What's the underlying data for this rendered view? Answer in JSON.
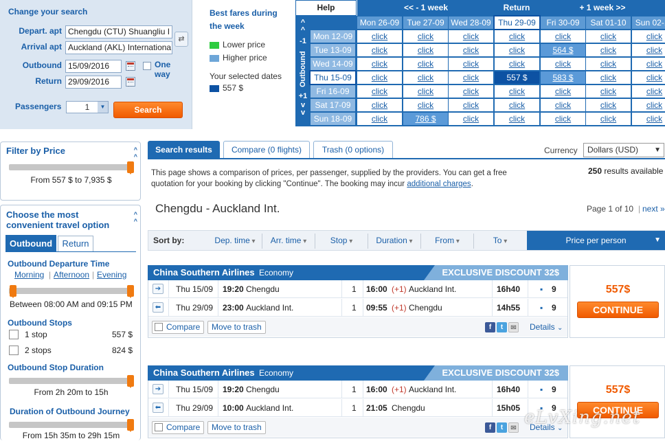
{
  "search": {
    "title": "Change your search",
    "depart_label": "Depart. apt",
    "depart_value": "Chengdu (CTU) Shuangliu I",
    "arrival_label": "Arrival apt",
    "arrival_value": "Auckland (AKL) Internationa",
    "outbound_label": "Outbound",
    "outbound_value": "15/09/2016",
    "return_label": "Return",
    "return_value": "29/09/2016",
    "oneway_label_1": "One",
    "oneway_label_2": "way",
    "passengers_label": "Passengers",
    "passengers_value": "1",
    "search_button": "Search"
  },
  "legend": {
    "title_1": "Best fares during",
    "title_2": "the week",
    "lower": "Lower price",
    "higher": "Higher price",
    "selected_title": "Your selected dates",
    "selected_price": "557 $",
    "colors": {
      "lower": "#2ecc40",
      "higher": "#6ea6d8",
      "selected": "#0d52a3"
    }
  },
  "calendar": {
    "help": "Help",
    "prev_week": "<< - 1 week",
    "return_label": "Return",
    "next_week": "+ 1 week >>",
    "outbound_side": "Outbound",
    "side_marks": [
      "^^",
      "-1",
      "+1",
      "vv"
    ],
    "columns": [
      "Mon 26-09",
      "Tue 27-09",
      "Wed 28-09",
      "Thu 29-09",
      "Fri 30-09",
      "Sat 01-10",
      "Sun 02-10"
    ],
    "rows": [
      {
        "label": "Mon 12-09",
        "cells": [
          "click",
          "click",
          "click",
          "click",
          "click",
          "click",
          "click"
        ]
      },
      {
        "label": "Tue 13-09",
        "cells": [
          "click",
          "click",
          "click",
          "click",
          "564 $",
          "click",
          "click"
        ]
      },
      {
        "label": "Wed 14-09",
        "cells": [
          "click",
          "click",
          "click",
          "click",
          "click",
          "click",
          "click"
        ]
      },
      {
        "label": "Thu 15-09",
        "cells": [
          "click",
          "click",
          "click",
          "557 $",
          "583 $",
          "click",
          "click"
        ]
      },
      {
        "label": "Fri 16-09",
        "cells": [
          "click",
          "click",
          "click",
          "click",
          "click",
          "click",
          "click"
        ]
      },
      {
        "label": "Sat 17-09",
        "cells": [
          "click",
          "click",
          "click",
          "click",
          "click",
          "click",
          "click"
        ]
      },
      {
        "label": "Sun 18-09",
        "cells": [
          "click",
          "786 $",
          "click",
          "click",
          "click",
          "click",
          "click"
        ]
      }
    ]
  },
  "filters": {
    "price_title": "Filter by Price",
    "price_range": "From 557 $ to 7,935 $",
    "travel_title_1": "Choose the most",
    "travel_title_2": "convenient travel option",
    "tab_outbound": "Outbound",
    "tab_return": "Return",
    "dep_time_title": "Outbound Departure Time",
    "dep_morning": "Morning",
    "dep_afternoon": "Afternoon",
    "dep_evening": "Evening",
    "dep_range": "Between 08:00 AM and 09:15 PM",
    "stops_title": "Outbound Stops",
    "stop1_label": "1 stop",
    "stop1_price": "557 $",
    "stop2_label": "2 stops",
    "stop2_price": "824 $",
    "stop_dur_title": "Outbound Stop Duration",
    "stop_dur_range": "From 2h 20m to 15h",
    "journey_title": "Duration of Outbound Journey",
    "journey_range": "From 15h 35m to 29h 15m"
  },
  "results": {
    "tab_search": "Search results",
    "tab_compare": "Compare (0 flights)",
    "tab_trash": "Trash (0 options)",
    "currency_label": "Currency",
    "currency_value": "Dollars (USD)",
    "info_1": "This page shows a comparison of prices, per passenger, supplied by the providers. You can get a free",
    "info_2": "quotation for your booking by clicking \"Continue\". The booking may incur",
    "info_link": "additional charges",
    "info_end": ".",
    "count": "250",
    "count_label": "results available",
    "route_title": "Chengdu - Auckland Int.",
    "page_info": "Page 1 of 10",
    "next": "next »",
    "sort_by": "Sort by:",
    "sort_items": [
      "Dep. time",
      "Arr. time",
      "Stop",
      "Duration",
      "From",
      "To"
    ],
    "sort_active": "Price per person"
  },
  "cards": [
    {
      "airline": "China Southern Airlines",
      "cabin": "Economy",
      "discount": "EXCLUSIVE DISCOUNT 32$",
      "legs": [
        {
          "date": "Thu 15/09",
          "dep": "19:20",
          "from": "Chengdu",
          "stops": "1",
          "arr": "16:00",
          "plus": "(+1)",
          "to": "Auckland Int.",
          "dur": "16h40",
          "seats": "9"
        },
        {
          "date": "Thu 29/09",
          "dep": "23:00",
          "from": "Auckland Int.",
          "stops": "1",
          "arr": "09:55",
          "plus": "(+1)",
          "to": "Chengdu",
          "dur": "14h55",
          "seats": "9"
        }
      ],
      "compare": "Compare",
      "trash": "Move to trash",
      "details": "Details",
      "price": "557$",
      "continue": "CONTINUE"
    },
    {
      "airline": "China Southern Airlines",
      "cabin": "Economy",
      "discount": "EXCLUSIVE DISCOUNT 32$",
      "legs": [
        {
          "date": "Thu 15/09",
          "dep": "19:20",
          "from": "Chengdu",
          "stops": "1",
          "arr": "16:00",
          "plus": "(+1)",
          "to": "Auckland Int.",
          "dur": "16h40",
          "seats": "9"
        },
        {
          "date": "Thu 29/09",
          "dep": "10:00",
          "from": "Auckland Int.",
          "stops": "1",
          "arr": "21:05",
          "plus": "",
          "to": "Chengdu",
          "dur": "15h05",
          "seats": "9"
        }
      ],
      "compare": "Compare",
      "trash": "Move to trash",
      "details": "Details",
      "price": "557$",
      "continue": "CONTINUE"
    }
  ],
  "watermark": "eLvXing.net"
}
